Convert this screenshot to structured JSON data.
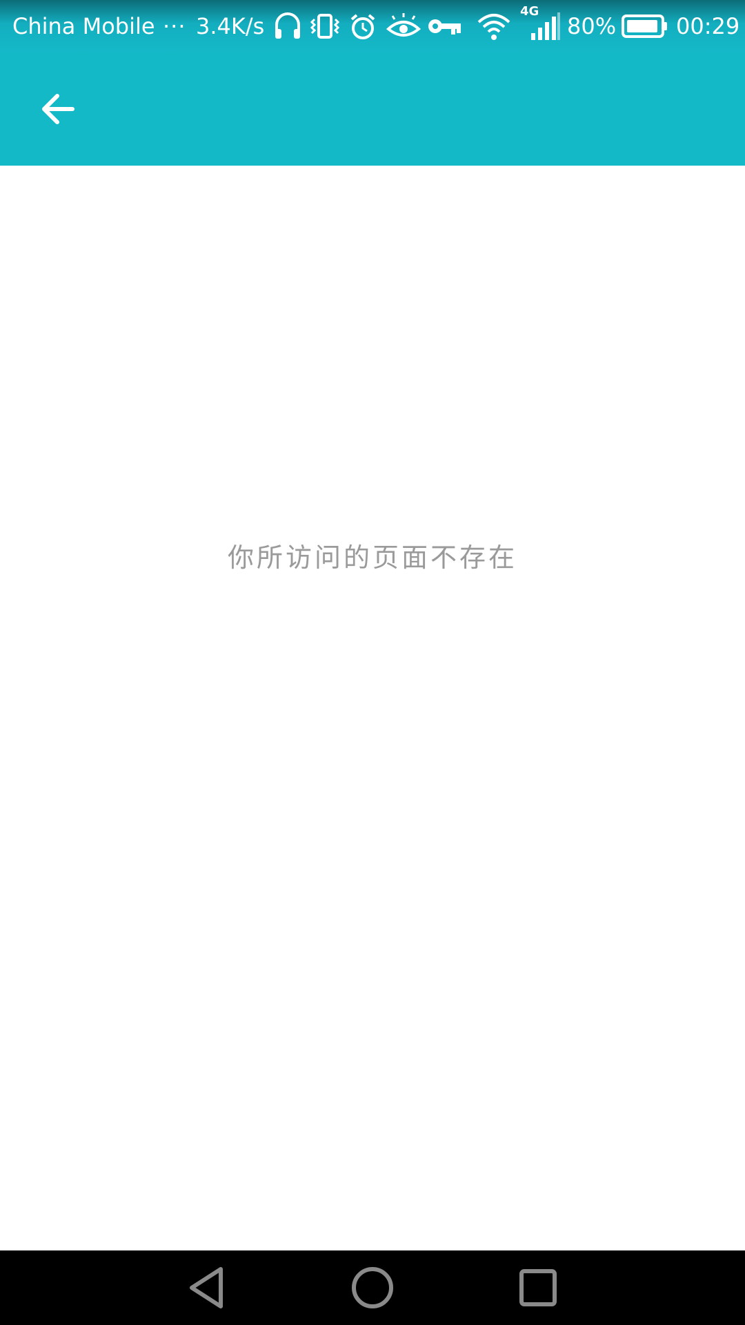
{
  "status_bar": {
    "carrier": "China Mobile",
    "more": "···",
    "speed": "3.4K/s",
    "network_type": "4G",
    "battery": "80%",
    "time": "00:29",
    "icons": [
      "headphones-icon",
      "vibrate-icon",
      "alarm-icon",
      "eye-icon",
      "key-icon",
      "wifi-icon",
      "signal-icon",
      "battery-icon"
    ]
  },
  "app_bar": {
    "back_icon": "arrow-left-icon",
    "color": "#14b9c8"
  },
  "content": {
    "message": "你所访问的页面不存在",
    "message_color": "#9a9a9a"
  },
  "nav_bar": {
    "buttons": [
      "back-triangle-icon",
      "home-circle-icon",
      "recents-square-icon"
    ]
  }
}
